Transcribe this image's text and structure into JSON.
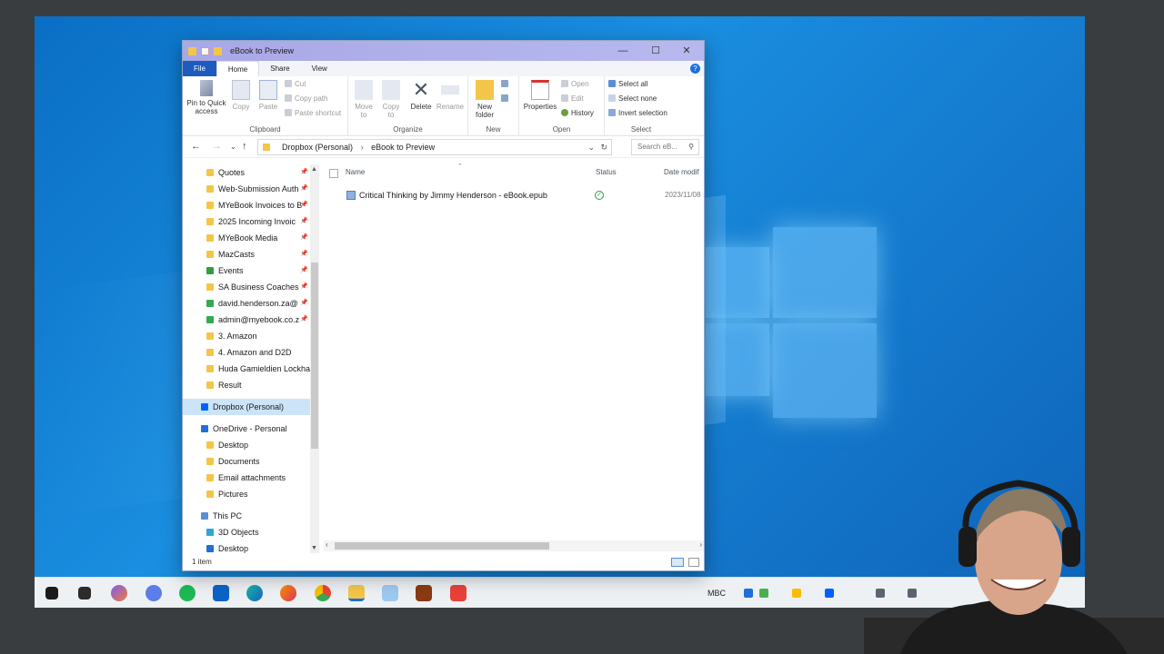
{
  "window": {
    "title": "eBook to Preview",
    "min_label": "—",
    "max_label": "☐",
    "close_label": "✕"
  },
  "ribbon_tabs": [
    {
      "label": "File"
    },
    {
      "label": "Home"
    },
    {
      "label": "Share"
    },
    {
      "label": "View"
    }
  ],
  "help_label": "?",
  "ribbon": {
    "clipboard": {
      "label": "Clipboard",
      "pin_label": "Pin to Quick access",
      "copy_label": "Copy",
      "paste_label": "Paste",
      "cut_label": "Cut",
      "copy_path_label": "Copy path",
      "paste_shortcut_label": "Paste shortcut"
    },
    "organize": {
      "label": "Organize",
      "move_to_label": "Move to",
      "copy_to_label": "Copy to",
      "delete_label": "Delete",
      "rename_label": "Rename"
    },
    "new": {
      "label": "New",
      "new_folder_label": "New folder"
    },
    "open": {
      "label": "Open",
      "properties_label": "Properties",
      "open_label": "Open",
      "edit_label": "Edit",
      "history_label": "History"
    },
    "select": {
      "label": "Select",
      "select_all_label": "Select all",
      "select_none_label": "Select none",
      "invert_label": "Invert selection"
    }
  },
  "address": {
    "crumb1": "Dropbox (Personal)",
    "crumb2": "eBook to Preview",
    "search_placeholder": "Search eB..."
  },
  "nav_items": [
    {
      "label": "Quotes"
    },
    {
      "label": "Web-Submission Auth"
    },
    {
      "label": "MYeBook Invoices to B"
    },
    {
      "label": "2025 Incoming Invoic"
    },
    {
      "label": "MYeBook Media"
    },
    {
      "label": "MazCasts"
    },
    {
      "label": "Events"
    },
    {
      "label": "SA Business Coaches"
    },
    {
      "label": "david.henderson.za@"
    },
    {
      "label": "admin@myebook.co.z"
    },
    {
      "label": "3. Amazon"
    },
    {
      "label": "4. Amazon and D2D"
    },
    {
      "label": "Huda Gamieldien Lockha"
    },
    {
      "label": "Result"
    },
    {
      "label": "Dropbox (Personal)"
    },
    {
      "label": "OneDrive - Personal"
    },
    {
      "label": "Desktop"
    },
    {
      "label": "Documents"
    },
    {
      "label": "Email attachments"
    },
    {
      "label": "Pictures"
    },
    {
      "label": "This PC"
    },
    {
      "label": "3D Objects"
    },
    {
      "label": "Desktop"
    }
  ],
  "columns": {
    "name": "Name",
    "status": "Status",
    "date": "Date modif"
  },
  "files": [
    {
      "name": "Critical Thinking by Jimmy Henderson - eBook.epub",
      "date": "2023/11/08"
    }
  ],
  "status_bar": "1 item",
  "taskbar": {
    "language": "MBC"
  },
  "colors": {
    "accent": "#1e5bbf",
    "selected": "#cce4f7",
    "folder": "#f3c64a"
  }
}
